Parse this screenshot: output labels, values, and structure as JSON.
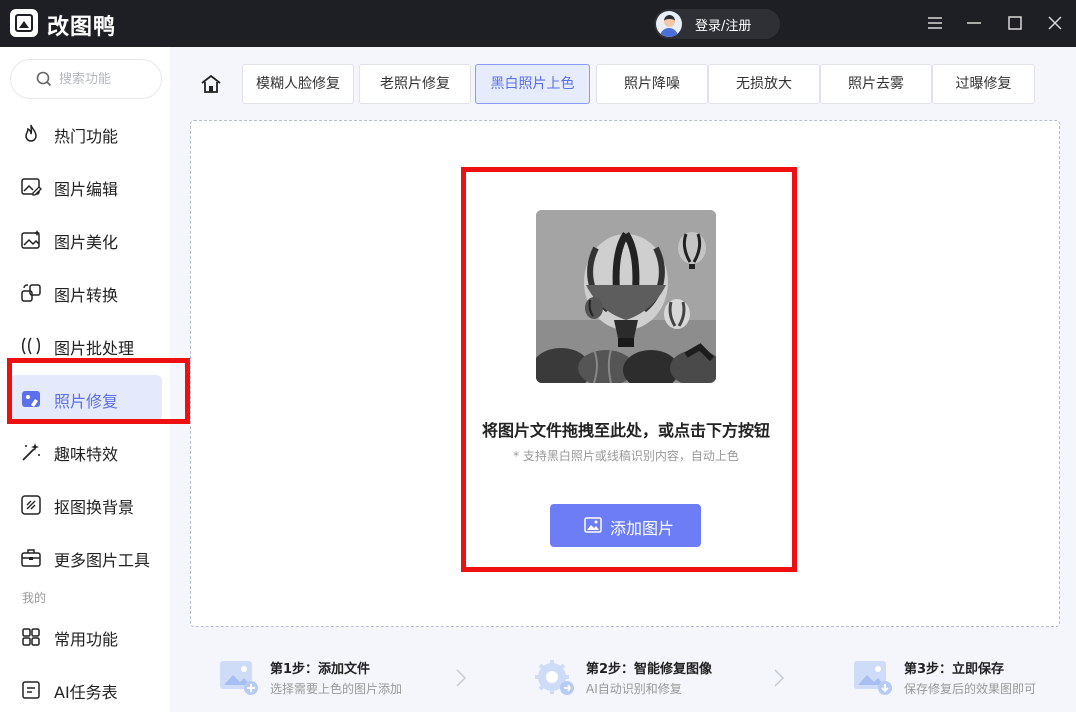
{
  "app": {
    "title": "改图鸭",
    "login_label": "登录/注册"
  },
  "search": {
    "placeholder": "搜索功能"
  },
  "sidebar": {
    "items": [
      {
        "label": "热门功能",
        "icon": "fire-icon"
      },
      {
        "label": "图片编辑",
        "icon": "image-edit-icon"
      },
      {
        "label": "图片美化",
        "icon": "image-beautify-icon"
      },
      {
        "label": "图片转换",
        "icon": "convert-icon"
      },
      {
        "label": "图片批处理",
        "icon": "batch-icon"
      },
      {
        "label": "照片修复",
        "icon": "photo-repair-icon",
        "active": true
      },
      {
        "label": "趣味特效",
        "icon": "magic-wand-icon"
      },
      {
        "label": "抠图换背景",
        "icon": "cutout-icon"
      },
      {
        "label": "更多图片工具",
        "icon": "toolbox-icon"
      }
    ],
    "section_label": "我的",
    "my_items": [
      {
        "label": "常用功能",
        "icon": "grid-icon"
      },
      {
        "label": "AI任务表",
        "icon": "task-list-icon"
      }
    ]
  },
  "tabs": [
    {
      "label": "模糊人脸修复"
    },
    {
      "label": "老照片修复"
    },
    {
      "label": "黑白照片上色",
      "active": true
    },
    {
      "label": "照片降噪"
    },
    {
      "label": "无损放大"
    },
    {
      "label": "照片去雾"
    },
    {
      "label": "过曝修复"
    }
  ],
  "upload": {
    "main_text": "将图片文件拖拽至此处，或点击下方按钮",
    "sub_text": "* 支持黑白照片或线稿识别内容，自动上色",
    "button_label": "添加图片"
  },
  "steps": [
    {
      "title": "第1步：添加文件",
      "desc": "选择需要上色的图片添加"
    },
    {
      "title": "第2步：智能修复图像",
      "desc": "AI自动识别和修复"
    },
    {
      "title": "第3步：立即保存",
      "desc": "保存修复后的效果图即可"
    }
  ],
  "colors": {
    "accent": "#6d7df5",
    "titlebar": "#1e1f24",
    "highlight": "#ee1010"
  }
}
